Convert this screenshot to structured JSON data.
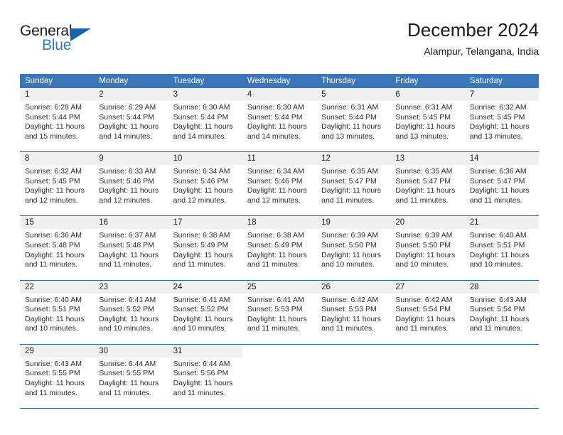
{
  "brand": {
    "name_part1": "General",
    "name_part2": "Blue",
    "logo_icon": "blue-triangle-icon"
  },
  "header": {
    "title": "December 2024",
    "subtitle": "Alampur, Telangana, India"
  },
  "colors": {
    "header_blue": "#3A76B8",
    "rule_blue": "#1F6FB2",
    "daynum_bg": "#F0F0F0",
    "brand_blue": "#2E7CC4",
    "text": "#2a2a2a"
  },
  "weekdays": [
    "Sunday",
    "Monday",
    "Tuesday",
    "Wednesday",
    "Thursday",
    "Friday",
    "Saturday"
  ],
  "weeks": [
    [
      {
        "day": "1",
        "lines": [
          "Sunrise: 6:28 AM",
          "Sunset: 5:44 PM",
          "Daylight: 11 hours",
          "and 15 minutes."
        ]
      },
      {
        "day": "2",
        "lines": [
          "Sunrise: 6:29 AM",
          "Sunset: 5:44 PM",
          "Daylight: 11 hours",
          "and 14 minutes."
        ]
      },
      {
        "day": "3",
        "lines": [
          "Sunrise: 6:30 AM",
          "Sunset: 5:44 PM",
          "Daylight: 11 hours",
          "and 14 minutes."
        ]
      },
      {
        "day": "4",
        "lines": [
          "Sunrise: 6:30 AM",
          "Sunset: 5:44 PM",
          "Daylight: 11 hours",
          "and 14 minutes."
        ]
      },
      {
        "day": "5",
        "lines": [
          "Sunrise: 6:31 AM",
          "Sunset: 5:44 PM",
          "Daylight: 11 hours",
          "and 13 minutes."
        ]
      },
      {
        "day": "6",
        "lines": [
          "Sunrise: 6:31 AM",
          "Sunset: 5:45 PM",
          "Daylight: 11 hours",
          "and 13 minutes."
        ]
      },
      {
        "day": "7",
        "lines": [
          "Sunrise: 6:32 AM",
          "Sunset: 5:45 PM",
          "Daylight: 11 hours",
          "and 13 minutes."
        ]
      }
    ],
    [
      {
        "day": "8",
        "lines": [
          "Sunrise: 6:32 AM",
          "Sunset: 5:45 PM",
          "Daylight: 11 hours",
          "and 12 minutes."
        ]
      },
      {
        "day": "9",
        "lines": [
          "Sunrise: 6:33 AM",
          "Sunset: 5:46 PM",
          "Daylight: 11 hours",
          "and 12 minutes."
        ]
      },
      {
        "day": "10",
        "lines": [
          "Sunrise: 6:34 AM",
          "Sunset: 5:46 PM",
          "Daylight: 11 hours",
          "and 12 minutes."
        ]
      },
      {
        "day": "11",
        "lines": [
          "Sunrise: 6:34 AM",
          "Sunset: 5:46 PM",
          "Daylight: 11 hours",
          "and 12 minutes."
        ]
      },
      {
        "day": "12",
        "lines": [
          "Sunrise: 6:35 AM",
          "Sunset: 5:47 PM",
          "Daylight: 11 hours",
          "and 11 minutes."
        ]
      },
      {
        "day": "13",
        "lines": [
          "Sunrise: 6:35 AM",
          "Sunset: 5:47 PM",
          "Daylight: 11 hours",
          "and 11 minutes."
        ]
      },
      {
        "day": "14",
        "lines": [
          "Sunrise: 6:36 AM",
          "Sunset: 5:47 PM",
          "Daylight: 11 hours",
          "and 11 minutes."
        ]
      }
    ],
    [
      {
        "day": "15",
        "lines": [
          "Sunrise: 6:36 AM",
          "Sunset: 5:48 PM",
          "Daylight: 11 hours",
          "and 11 minutes."
        ]
      },
      {
        "day": "16",
        "lines": [
          "Sunrise: 6:37 AM",
          "Sunset: 5:48 PM",
          "Daylight: 11 hours",
          "and 11 minutes."
        ]
      },
      {
        "day": "17",
        "lines": [
          "Sunrise: 6:38 AM",
          "Sunset: 5:49 PM",
          "Daylight: 11 hours",
          "and 11 minutes."
        ]
      },
      {
        "day": "18",
        "lines": [
          "Sunrise: 6:38 AM",
          "Sunset: 5:49 PM",
          "Daylight: 11 hours",
          "and 11 minutes."
        ]
      },
      {
        "day": "19",
        "lines": [
          "Sunrise: 6:39 AM",
          "Sunset: 5:50 PM",
          "Daylight: 11 hours",
          "and 10 minutes."
        ]
      },
      {
        "day": "20",
        "lines": [
          "Sunrise: 6:39 AM",
          "Sunset: 5:50 PM",
          "Daylight: 11 hours",
          "and 10 minutes."
        ]
      },
      {
        "day": "21",
        "lines": [
          "Sunrise: 6:40 AM",
          "Sunset: 5:51 PM",
          "Daylight: 11 hours",
          "and 10 minutes."
        ]
      }
    ],
    [
      {
        "day": "22",
        "lines": [
          "Sunrise: 6:40 AM",
          "Sunset: 5:51 PM",
          "Daylight: 11 hours",
          "and 10 minutes."
        ]
      },
      {
        "day": "23",
        "lines": [
          "Sunrise: 6:41 AM",
          "Sunset: 5:52 PM",
          "Daylight: 11 hours",
          "and 10 minutes."
        ]
      },
      {
        "day": "24",
        "lines": [
          "Sunrise: 6:41 AM",
          "Sunset: 5:52 PM",
          "Daylight: 11 hours",
          "and 10 minutes."
        ]
      },
      {
        "day": "25",
        "lines": [
          "Sunrise: 6:41 AM",
          "Sunset: 5:53 PM",
          "Daylight: 11 hours",
          "and 11 minutes."
        ]
      },
      {
        "day": "26",
        "lines": [
          "Sunrise: 6:42 AM",
          "Sunset: 5:53 PM",
          "Daylight: 11 hours",
          "and 11 minutes."
        ]
      },
      {
        "day": "27",
        "lines": [
          "Sunrise: 6:42 AM",
          "Sunset: 5:54 PM",
          "Daylight: 11 hours",
          "and 11 minutes."
        ]
      },
      {
        "day": "28",
        "lines": [
          "Sunrise: 6:43 AM",
          "Sunset: 5:54 PM",
          "Daylight: 11 hours",
          "and 11 minutes."
        ]
      }
    ],
    [
      {
        "day": "29",
        "lines": [
          "Sunrise: 6:43 AM",
          "Sunset: 5:55 PM",
          "Daylight: 11 hours",
          "and 11 minutes."
        ]
      },
      {
        "day": "30",
        "lines": [
          "Sunrise: 6:44 AM",
          "Sunset: 5:55 PM",
          "Daylight: 11 hours",
          "and 11 minutes."
        ]
      },
      {
        "day": "31",
        "lines": [
          "Sunrise: 6:44 AM",
          "Sunset: 5:56 PM",
          "Daylight: 11 hours",
          "and 11 minutes."
        ]
      },
      {
        "day": "",
        "lines": []
      },
      {
        "day": "",
        "lines": []
      },
      {
        "day": "",
        "lines": []
      },
      {
        "day": "",
        "lines": []
      }
    ]
  ]
}
